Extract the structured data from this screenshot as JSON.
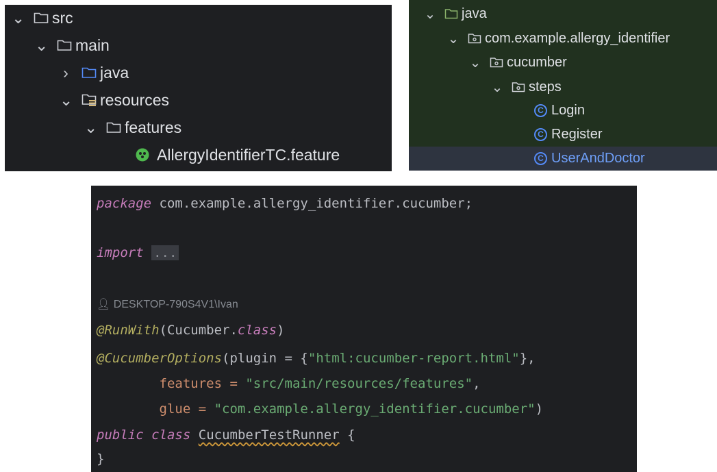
{
  "project_tree": {
    "items": [
      {
        "label": "src",
        "icon": "folder-icon",
        "expanded": true
      },
      {
        "label": "main",
        "icon": "folder-icon",
        "expanded": true
      },
      {
        "label": "java",
        "icon": "source-folder-icon",
        "expanded": false
      },
      {
        "label": "resources",
        "icon": "resources-folder-icon",
        "expanded": true
      },
      {
        "label": "features",
        "icon": "folder-icon",
        "expanded": true
      },
      {
        "label": "AllergyIdentifierTC.feature",
        "icon": "cucumber-feature-icon"
      }
    ]
  },
  "package_tree": {
    "items": [
      {
        "label": "java",
        "icon": "source-folder-icon",
        "expanded": true
      },
      {
        "label": "com.example.allergy_identifier",
        "icon": "package-icon",
        "expanded": true
      },
      {
        "label": "cucumber",
        "icon": "package-icon",
        "expanded": true
      },
      {
        "label": "steps",
        "icon": "package-icon",
        "expanded": true
      },
      {
        "label": "Login",
        "icon": "class-icon",
        "glyph": "C"
      },
      {
        "label": "Register",
        "icon": "class-icon",
        "glyph": "C"
      },
      {
        "label": "UserAndDoctor",
        "icon": "class-icon",
        "glyph": "C",
        "selected": true
      }
    ]
  },
  "code": {
    "package_kw": "package",
    "package_name": " com.example.allergy_identifier.cucumber;",
    "import_kw": "import",
    "import_fold": "...",
    "author": "DESKTOP-790S4V1\\Ivan",
    "runwith_ann": "@RunWith",
    "runwith_open": "(Cucumber.",
    "class_kw": "class",
    "runwith_close": ")",
    "options_ann": "@CucumberOptions",
    "options_open": "(plugin = {",
    "plugin_value": "\"html:cucumber-report.html\"",
    "options_after_plugin": "},",
    "features_key": "        features = ",
    "features_value": "\"src/main/resources/features\"",
    "features_comma": ",",
    "glue_key": "        glue = ",
    "glue_value": "\"com.example.allergy_identifier.cucumber\"",
    "glue_close": ")",
    "public_kw": "public",
    "class_kw2": "class",
    "class_name": "CucumberTestRunner",
    "brace_open": " {",
    "brace_close": "}"
  },
  "colors": {
    "editor_bg": "#1e1f22",
    "keyword": "#c77dbb",
    "string": "#6aab73",
    "annotation": "#b3ae60",
    "class_icon": "#548af7"
  }
}
